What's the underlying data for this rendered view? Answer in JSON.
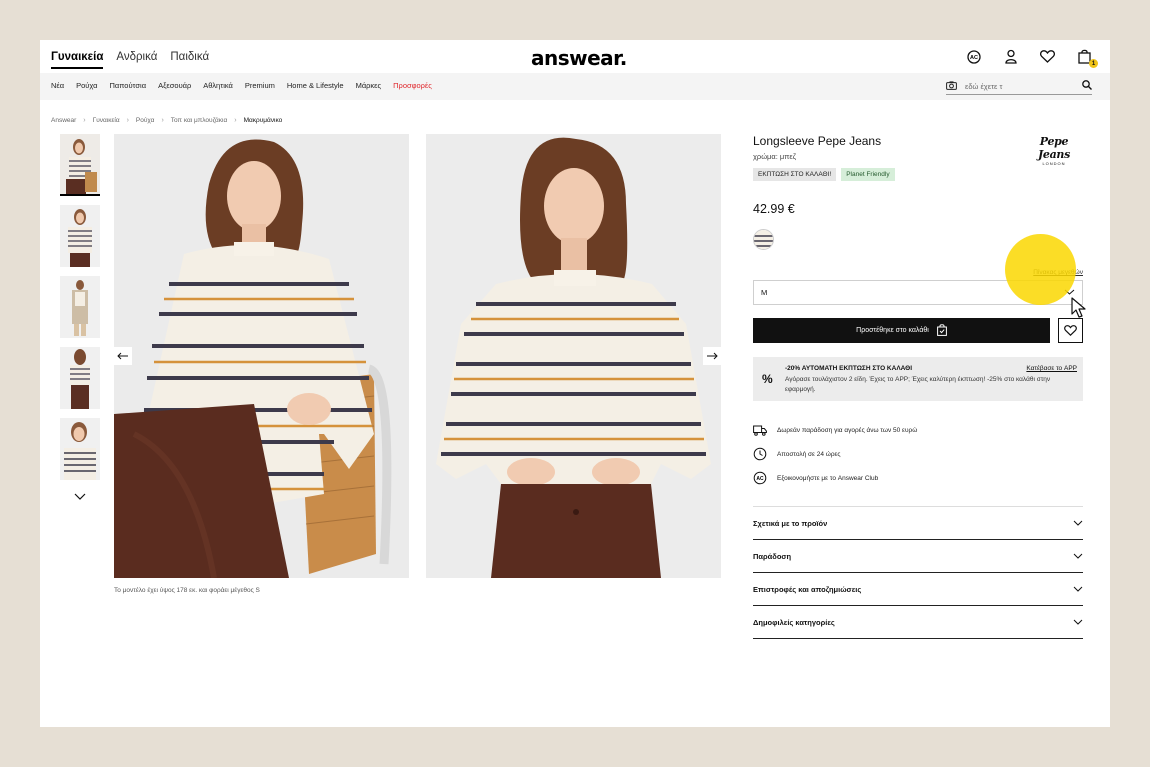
{
  "header": {
    "gender_tabs": [
      "Γυναικεία",
      "Ανδρικά",
      "Παιδικά"
    ],
    "logo": "answear.",
    "cart_count": "1",
    "icons": [
      "ac-club-icon",
      "user-icon",
      "heart-icon",
      "bag-icon"
    ]
  },
  "nav": {
    "items": [
      "Νέα",
      "Ρούχα",
      "Παπούτσια",
      "Αξεσουάρ",
      "Αθλητικά",
      "Premium",
      "Home & Lifestyle",
      "Μάρκες",
      "Προσφορές"
    ],
    "sale_color": "#e0262b",
    "search_placeholder": "εδώ έχετε τ"
  },
  "breadcrumb": [
    "Answear",
    "Γυναικεία",
    "Ρούχα",
    "Τοπ και μπλουζάκια",
    "Μακρυμάνικο"
  ],
  "gallery": {
    "caption": "Το μοντέλο έχει ύψος 178 εκ. και φοράει μέγεθος S"
  },
  "product": {
    "name": "Longsleeve Pepe Jeans",
    "color": "χρώμα: μπεζ",
    "brand_logo": "Pepe Jeans",
    "brand_logo_sub": "LONDON",
    "badges": [
      "ΕΚΠΤΩΣΗ ΣΤΟ ΚΑΛΑΘΙ!",
      "Planet Friendly"
    ],
    "price": "42.99 €",
    "size_chart": "Πίνακας μεγεθών",
    "size_selected": "M",
    "add_to_cart": "Προστέθηκε στο καλάθι",
    "promo": {
      "title": "-20% ΑΥΤΟΜΑΤΗ ΕΚΠΤΩΣΗ ΣΤΟ ΚΑΛΑΘΙ",
      "link": "Κατέβασε το APP",
      "text": "Αγόρασε τουλάχιστον 2 είδη. Έχεις το APP; Έχεις καλύτερη έκπτωση! -25% στο καλάθι στην εφαρμογή."
    },
    "perks": [
      "Δωρεάν παράδοση για αγορές άνω των 50 ευρώ",
      "Αποστολή σε 24 ώρες",
      "Εξοικονομήστε με το Answear Club"
    ],
    "accordion": [
      "Σχετικά με το προϊόν",
      "Παράδοση",
      "Επιστροφές και αποζημιώσεις",
      "Δημοφιλείς κατηγορίες"
    ]
  }
}
